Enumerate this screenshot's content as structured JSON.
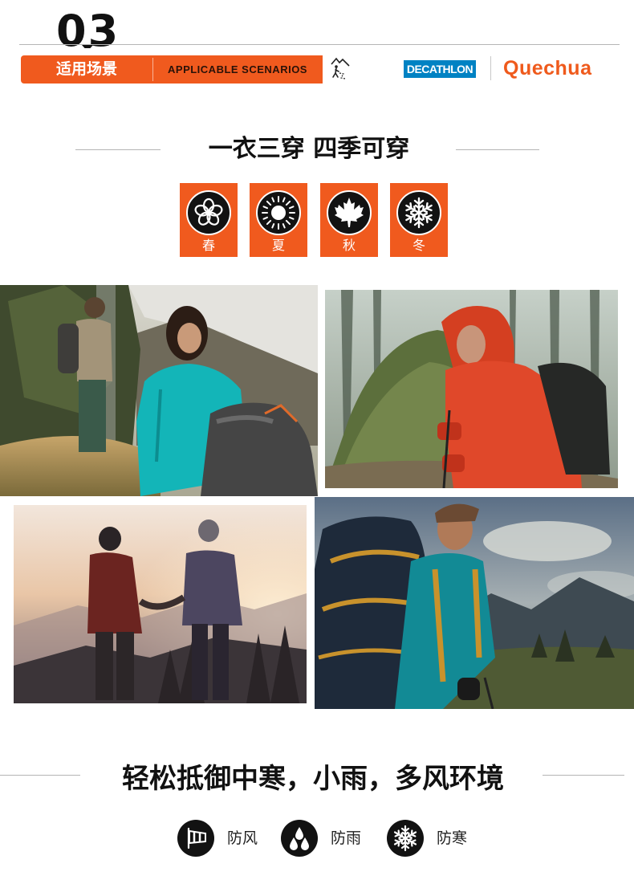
{
  "header": {
    "section_number": "03",
    "tag_cn": "适用场景",
    "tag_en": "APPLICABLE SCENARIOS",
    "tag_icon": "mountain-hiker-icon",
    "brand_decathlon": "DECATHLON",
    "brand_quechua": "Quechua",
    "colors": {
      "accent": "#f05a1e",
      "decathlon_blue": "#0082c3",
      "quechua_orange": "#ef5a1c"
    }
  },
  "heading_primary": "一衣三穿 四季可穿",
  "seasons": [
    {
      "label": "春",
      "icon": "flower-icon"
    },
    {
      "label": "夏",
      "icon": "sun-icon"
    },
    {
      "label": "秋",
      "icon": "maple-leaf-icon"
    },
    {
      "label": "冬",
      "icon": "snowflake-icon"
    }
  ],
  "photos": [
    {
      "name": "hikers-waterfall-photo"
    },
    {
      "name": "hiker-forest-rock-photo"
    },
    {
      "name": "couple-sunset-photo"
    },
    {
      "name": "hiker-backpack-mountain-photo"
    }
  ],
  "heading_secondary": "轻松抵御中寒，小雨，多风环境",
  "features": [
    {
      "label": "防风",
      "icon": "windsock-icon"
    },
    {
      "label": "防雨",
      "icon": "raindrops-icon"
    },
    {
      "label": "防寒",
      "icon": "snowflake-icon"
    }
  ]
}
